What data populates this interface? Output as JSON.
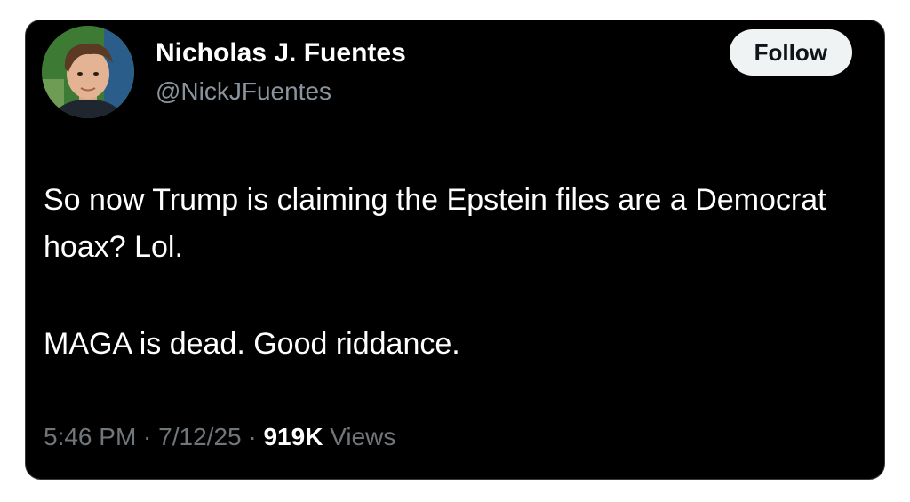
{
  "tweet": {
    "author": {
      "name": "Nicholas J. Fuentes",
      "handle": "@NickJFuentes"
    },
    "follow_label": "Follow",
    "text": {
      "line1": "So now Trump is claiming the Epstein files are a Democrat hoax? Lol.",
      "line2": "MAGA is dead. Good riddance."
    },
    "meta": {
      "time": "5:46 PM",
      "sep1": " · ",
      "date": "7/12/25",
      "sep2": " · ",
      "views_count": "919K",
      "views_label": " Views"
    }
  },
  "colors": {
    "background": "#000000",
    "text_primary": "#ffffff",
    "text_secondary": "#71767b",
    "button_bg": "#eff3f4"
  }
}
